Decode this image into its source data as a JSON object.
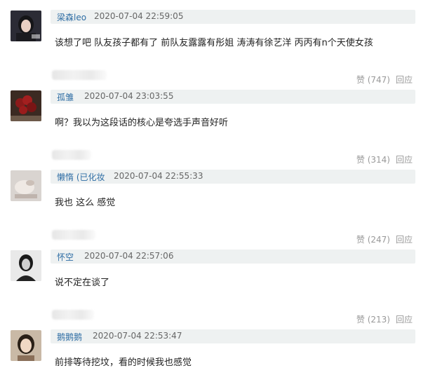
{
  "comments": [
    {
      "username": "梁森leo",
      "time": "2020-07-04 22:59:05",
      "text": "该想了吧 队友孩子都有了 前队友露露有彤姐 涛涛有徐艺洋 丙丙有n个天使女孩",
      "like_label": "赞 (747)",
      "reply_label": "回应",
      "avatar": {
        "icon": "portrait-woman-dark-hair-icon",
        "bg": "#3a3a46"
      }
    },
    {
      "username": "孤雏",
      "time": "2020-07-04 23:03:55",
      "text": "啊？我以为这段话的核心是夸选手声音好听",
      "like_label": "赞 (314)",
      "reply_label": "回应",
      "avatar": {
        "icon": "red-roses-icon",
        "bg": "#3b2a22"
      }
    },
    {
      "username": "懒惰 (已化妆",
      "time": "2020-07-04 22:55:33",
      "text": "我也 这么 感觉",
      "like_label": "赞 (247)",
      "reply_label": "回应",
      "avatar": {
        "icon": "pale-hand-photo-icon",
        "bg": "#d9d4d0"
      }
    },
    {
      "username": "怀空",
      "time": "2020-07-04 22:57:06",
      "text": "说不定在谈了",
      "like_label": "赞 (213)",
      "reply_label": "回应",
      "avatar": {
        "icon": "bw-portrait-icon",
        "bg": "#e9e9e9"
      }
    },
    {
      "username": "鹅鹅鹅",
      "time": "2020-07-04 22:53:47",
      "text": "前排等待挖坟，看的时候我也感觉",
      "avatar": {
        "icon": "woman-portrait-icon",
        "bg": "#c9b9a6"
      }
    }
  ]
}
